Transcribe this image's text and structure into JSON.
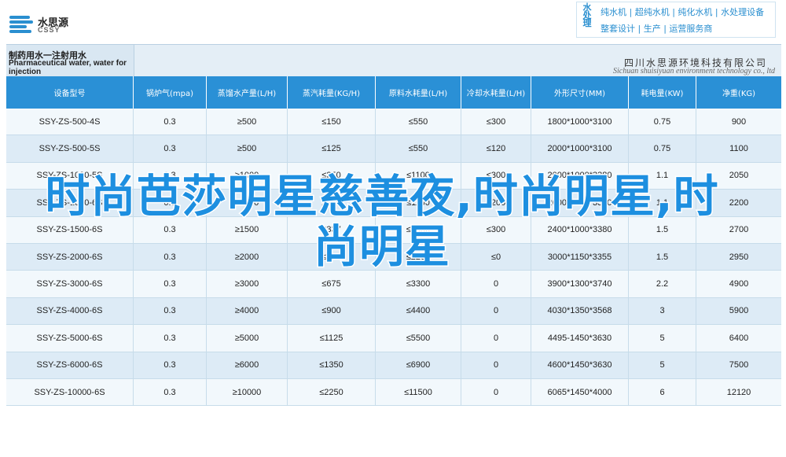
{
  "header": {
    "logo": {
      "cn": "水思源",
      "en": "CSSY"
    },
    "vertical_text": "水处理",
    "line1": "纯水机 | 超纯水机 | 纯化水机 | 水处理设备",
    "line2": "整套设计 | 生产 | 运营服务商"
  },
  "table": {
    "model_label_cn": "制药用水一注射用水",
    "model_label_en": "Pharmaceutical water, water for injection",
    "company_cn": "四川水思源环境科技有限公司",
    "company_en": "Sichuan shuisiyuan environment technology co., ltd",
    "columns": [
      "设备型号",
      "锅炉气(mpa)",
      "蒸馏水产量(L/H)",
      "蒸汽耗量(KG/H)",
      "原料水耗量(L/H)",
      "冷却水耗量(L/H)",
      "外形尺寸(MM)",
      "耗电量(KW)",
      "净重(KG)"
    ],
    "rows": [
      [
        "SSY-ZS-500-4S",
        "0.3",
        "≥500",
        "≤150",
        "≤550",
        "≤300",
        "1800*1000*3100",
        "0.75",
        "900"
      ],
      [
        "SSY-ZS-500-5S",
        "0.3",
        "≥500",
        "≤125",
        "≤550",
        "≤120",
        "2000*1000*3100",
        "0.75",
        "1100"
      ],
      [
        "SSY-ZS-1000-5S",
        "0.3",
        "≥1000",
        "≤250",
        "≤1100",
        "≤300",
        "2000*1000*3380",
        "1.1",
        "2050"
      ],
      [
        "SSY-ZS-1000-6S",
        "0.3",
        "≥1000",
        "≤225",
        "≤1100",
        "≤200",
        "2000*1000*3380",
        "1.1",
        "2200"
      ],
      [
        "SSY-ZS-1500-6S",
        "0.3",
        "≥1500",
        "≤337",
        "≤1650",
        "≤300",
        "2400*1000*3380",
        "1.5",
        "2700"
      ],
      [
        "SSY-ZS-2000-6S",
        "0.3",
        "≥2000",
        "≤450",
        "≤2200",
        "≤0",
        "3000*1150*3355",
        "1.5",
        "2950"
      ],
      [
        "SSY-ZS-3000-6S",
        "0.3",
        "≥3000",
        "≤675",
        "≤3300",
        "0",
        "3900*1300*3740",
        "2.2",
        "4900"
      ],
      [
        "SSY-ZS-4000-6S",
        "0.3",
        "≥4000",
        "≤900",
        "≤4400",
        "0",
        "4030*1350*3568",
        "3",
        "5900"
      ],
      [
        "SSY-ZS-5000-6S",
        "0.3",
        "≥5000",
        "≤1125",
        "≤5500",
        "0",
        "4495-1450*3630",
        "5",
        "6400"
      ],
      [
        "SSY-ZS-6000-6S",
        "0.3",
        "≥6000",
        "≤1350",
        "≤6900",
        "0",
        "4600*1450*3630",
        "5",
        "7500"
      ],
      [
        "SSY-ZS-10000-6S",
        "0.3",
        "≥10000",
        "≤2250",
        "≤11500",
        "0",
        "6065*1450*4000",
        "6",
        "12120"
      ]
    ]
  },
  "overlay_title": "时尚芭莎明星慈善夜,时尚明星,时尚明星"
}
